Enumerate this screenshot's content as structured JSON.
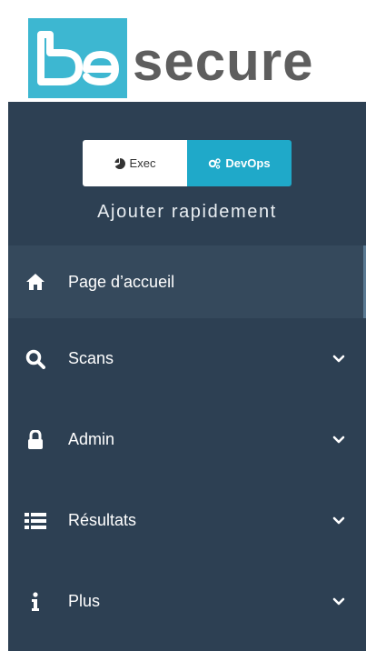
{
  "logo": {
    "prefix": "be",
    "word": "secure"
  },
  "view_toggle": {
    "exec_label": "Exec",
    "devops_label": "DevOps",
    "selected": "DevOps"
  },
  "quick_add": "Ajouter rapidement",
  "nav": {
    "items": [
      {
        "label": "Page d’accueil",
        "icon": "home-icon",
        "active": true
      },
      {
        "label": "Scans",
        "icon": "search-icon"
      },
      {
        "label": "Admin",
        "icon": "lock-icon"
      },
      {
        "label": "Résultats",
        "icon": "list-icon"
      },
      {
        "label": "Plus",
        "icon": "info-icon"
      }
    ]
  },
  "colors": {
    "sidebar_bg": "#2d4053",
    "active_bg": "#35495c",
    "brand_teal": "#3db7d1",
    "toggle_active": "#1fa9c9",
    "logo_text": "#5e5e5e"
  }
}
